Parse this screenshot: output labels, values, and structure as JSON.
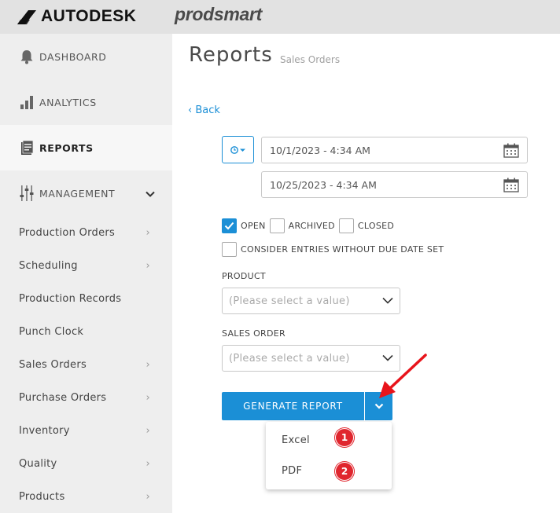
{
  "brand": {
    "autodesk": "AUTODESK",
    "prodsmart": "prodsmart"
  },
  "sidebar": {
    "main": [
      {
        "label": "DASHBOARD",
        "icon": "bell-icon"
      },
      {
        "label": "ANALYTICS",
        "icon": "bar-chart-icon"
      },
      {
        "label": "REPORTS",
        "icon": "document-icon",
        "active": true
      },
      {
        "label": "MANAGEMENT",
        "icon": "sliders-icon",
        "expanded": true
      }
    ],
    "sub": [
      {
        "label": "Production Orders",
        "chevron": true
      },
      {
        "label": "Scheduling",
        "chevron": true
      },
      {
        "label": "Production Records",
        "chevron": false
      },
      {
        "label": "Punch Clock",
        "chevron": false
      },
      {
        "label": "Sales Orders",
        "chevron": true
      },
      {
        "label": "Purchase Orders",
        "chevron": true
      },
      {
        "label": "Inventory",
        "chevron": true
      },
      {
        "label": "Quality",
        "chevron": true
      },
      {
        "label": "Products",
        "chevron": true
      }
    ]
  },
  "page": {
    "title": "Reports",
    "subtitle": "Sales Orders",
    "back": "‹ Back"
  },
  "dates": {
    "start": "10/1/2023 - 4:34 AM",
    "end": "10/25/2023 - 4:34 AM"
  },
  "filters": {
    "open": {
      "label": "OPEN",
      "checked": true
    },
    "archived": {
      "label": "ARCHIVED",
      "checked": false
    },
    "closed": {
      "label": "CLOSED",
      "checked": false
    },
    "no_due_date": {
      "label": "CONSIDER ENTRIES WITHOUT DUE DATE SET",
      "checked": false
    }
  },
  "product": {
    "label": "PRODUCT",
    "placeholder": "(Please select a value)"
  },
  "sales_order": {
    "label": "SALES ORDER",
    "placeholder": "(Please select a value)"
  },
  "generate": {
    "label": "GENERATE REPORT"
  },
  "export_menu": {
    "items": [
      {
        "label": "Excel",
        "badge": "1"
      },
      {
        "label": "PDF",
        "badge": "2"
      }
    ]
  },
  "colors": {
    "accent": "#1b8fd6",
    "badge": "#e0262e",
    "arrow": "#e8141b",
    "sidebar": "#eeeeee"
  }
}
